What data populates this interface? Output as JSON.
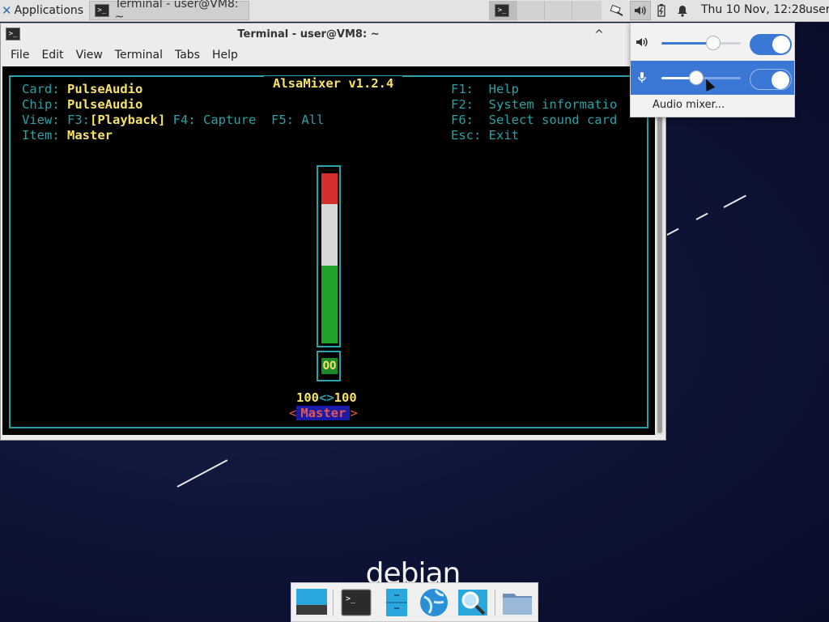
{
  "panel": {
    "applications_label": "Applications",
    "task_title": "Terminal - user@VM8: ~",
    "clock": "Thu 10 Nov, 12:28",
    "user": "user"
  },
  "window": {
    "title": "Terminal - user@VM8: ~",
    "minimize_glyph": "^",
    "menu": [
      "File",
      "Edit",
      "View",
      "Terminal",
      "Tabs",
      "Help"
    ]
  },
  "alsamixer": {
    "title": "AlsaMixer v1.2.4",
    "card_label": "Card:",
    "card_value": "PulseAudio",
    "chip_label": "Chip:",
    "chip_value": "PulseAudio",
    "view_label": "View:",
    "view_f3": "F3:",
    "view_playback": "[Playback]",
    "view_rest": " F4: Capture  F5: All",
    "item_label": "Item:",
    "item_value": "Master",
    "help_f1": "F1:  Help",
    "help_f2": "F2:  System informatio",
    "help_f6": "F6:  Select sound card",
    "help_esc": "Esc: Exit",
    "mute_status": "OO",
    "volume_left": "100",
    "volume_sep": "<>",
    "volume_right": "100",
    "control_name": "Master",
    "bracket_left": "<",
    "bracket_right": ">",
    "level_fraction": 0.99
  },
  "sound_popup": {
    "speaker_level": 0.65,
    "mic_level": 0.44,
    "speaker_enabled": true,
    "mic_enabled": true,
    "mixer_link": "Audio mixer..."
  },
  "desktop": {
    "logo_text": "debian"
  },
  "colors": {
    "terminal_text": "#2aa1a6",
    "terminal_highlight": "#f4e26b",
    "bar_red": "#d32f2f",
    "bar_white": "#d8d8d8",
    "bar_green": "#22a32a",
    "accent_blue": "#3b78d6"
  },
  "icons": {
    "apps_menu": "xfce-mouse-icon",
    "terminal": "terminal-icon",
    "network": "network-icon",
    "volume": "speaker-icon",
    "battery": "battery-icon",
    "notifications": "bell-icon",
    "microphone": "microphone-icon"
  }
}
